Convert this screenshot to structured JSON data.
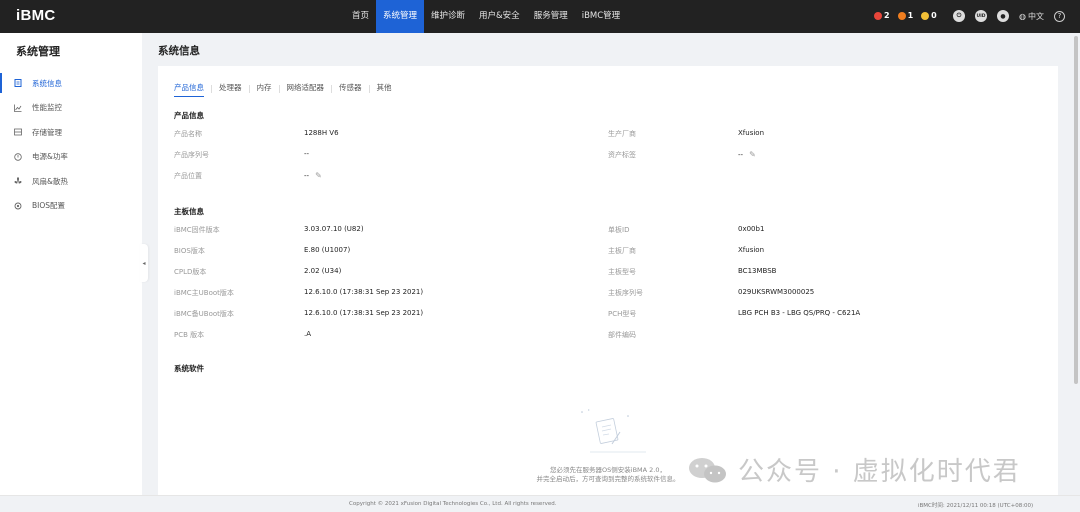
{
  "app": {
    "logo": "iBMC"
  },
  "nav": [
    {
      "label": "首页",
      "active": false
    },
    {
      "label": "系统管理",
      "active": true
    },
    {
      "label": "维护诊断",
      "active": false
    },
    {
      "label": "用户&安全",
      "active": false
    },
    {
      "label": "服务管理",
      "active": false
    },
    {
      "label": "iBMC管理",
      "active": false
    }
  ],
  "alerts": {
    "critical": {
      "count": "2",
      "color": "#e8463a"
    },
    "major": {
      "count": "1",
      "color": "#f07e1f"
    },
    "minor": {
      "count": "0",
      "color": "#f2c037"
    }
  },
  "toolbar": {
    "power_icon": "power-icon",
    "uid_label": "UID",
    "user_icon": "user-icon",
    "language": "中文",
    "help_label": "?"
  },
  "sidebar": {
    "title": "系统管理",
    "items": [
      {
        "label": "系统信息",
        "icon": "doc-icon",
        "active": true
      },
      {
        "label": "性能监控",
        "icon": "chart-icon",
        "active": false
      },
      {
        "label": "存储管理",
        "icon": "storage-icon",
        "active": false
      },
      {
        "label": "电源&功率",
        "icon": "power-icon",
        "active": false
      },
      {
        "label": "风扇&散热",
        "icon": "fan-icon",
        "active": false
      },
      {
        "label": "BIOS配置",
        "icon": "gear-icon",
        "active": false
      }
    ]
  },
  "page": {
    "title": "系统信息"
  },
  "tabs": [
    {
      "label": "产品信息",
      "active": true
    },
    {
      "label": "处理器",
      "active": false
    },
    {
      "label": "内存",
      "active": false
    },
    {
      "label": "网络适配器",
      "active": false
    },
    {
      "label": "传感器",
      "active": false
    },
    {
      "label": "其他",
      "active": false
    }
  ],
  "product": {
    "title": "产品信息",
    "name_label": "产品名称",
    "name_value": "1288H V6",
    "manufacturer_label": "生产厂商",
    "manufacturer_value": "Xfusion",
    "serial_label": "产品序列号",
    "serial_value": "--",
    "asset_label": "资产标签",
    "asset_value": "--",
    "location_label": "产品位置",
    "location_value": "--"
  },
  "board": {
    "title": "主板信息",
    "rows": [
      {
        "left_label": "iBMC固件版本",
        "left_value": "3.03.07.10 (U82)",
        "right_label": "单板ID",
        "right_value": "0x00b1"
      },
      {
        "left_label": "BIOS版本",
        "left_value": "E.80 (U1007)",
        "right_label": "主板厂商",
        "right_value": "Xfusion"
      },
      {
        "left_label": "CPLD版本",
        "left_value": "2.02 (U34)",
        "right_label": "主板型号",
        "right_value": "BC13MBSB"
      },
      {
        "left_label": "iBMC主UBoot版本",
        "left_value": "12.6.10.0  (17:38:31 Sep 23 2021)",
        "right_label": "主板序列号",
        "right_value": "029UKSRWM3000025"
      },
      {
        "left_label": "iBMC备UBoot版本",
        "left_value": "12.6.10.0  (17:38:31 Sep 23 2021)",
        "right_label": "PCH型号",
        "right_value": "LBG PCH B3 - LBG QS/PRQ - C621A"
      },
      {
        "left_label": "PCB 版本",
        "left_value": ".A",
        "right_label": "部件编码",
        "right_value": ""
      }
    ]
  },
  "software": {
    "title": "系统软件",
    "empty_line1": "您必须先在服务器OS侧安装iBMA 2.0，",
    "empty_line2": "并完全启动后，方可查询到完整的系统软件信息。"
  },
  "watermark": {
    "text": "公众号 · 虚拟化时代君"
  },
  "footer": {
    "copyright": "Copyright © 2021 xFusion Digital Technologies Co., Ltd. All rights reserved.",
    "time": "iBMC时间:   2021/12/11 00:18 (UTC+08:00)"
  }
}
